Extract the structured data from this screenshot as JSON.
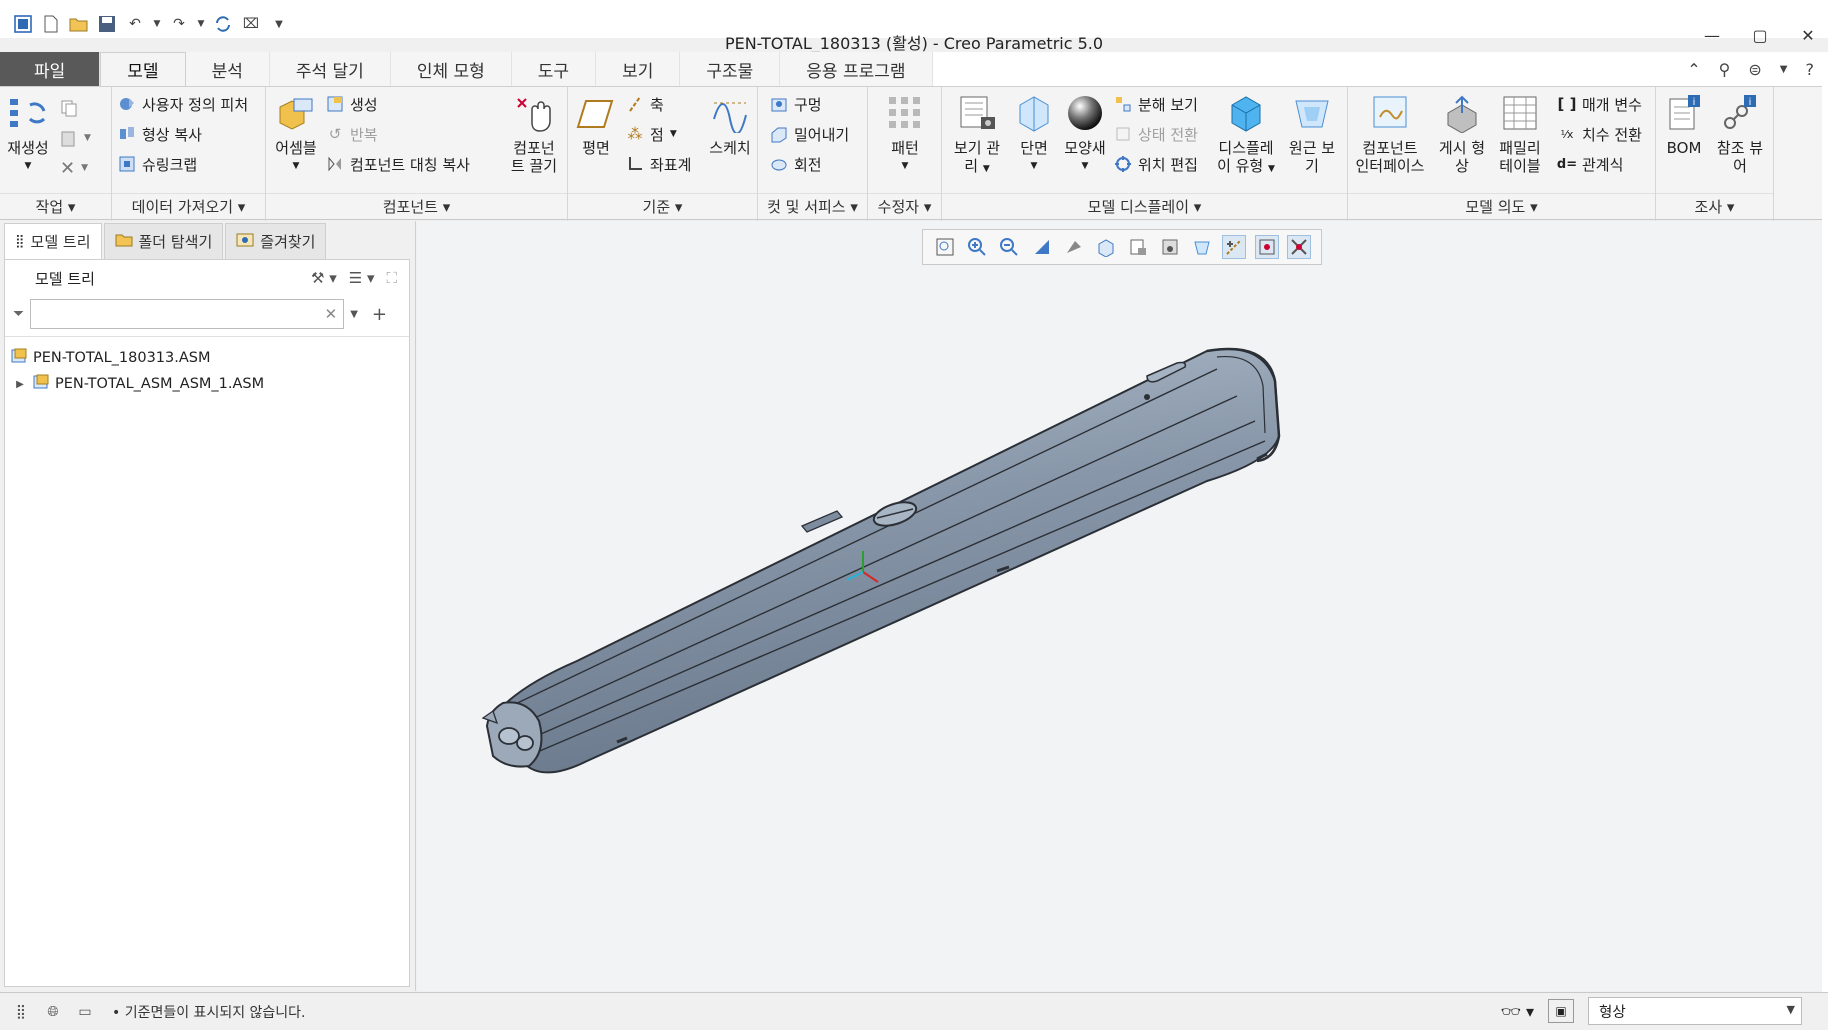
{
  "window": {
    "title": "PEN-TOTAL_180313 (활성) - Creo Parametric 5.0"
  },
  "tabs": [
    {
      "label": "파일"
    },
    {
      "label": "모델"
    },
    {
      "label": "분석"
    },
    {
      "label": "주석 달기"
    },
    {
      "label": "인체 모형"
    },
    {
      "label": "도구"
    },
    {
      "label": "보기"
    },
    {
      "label": "구조물"
    },
    {
      "label": "응용 프로그램"
    }
  ],
  "ribbon": {
    "groups": {
      "operations": "작업",
      "get_data": "데이터 가져오기",
      "component": "컴포넌트",
      "datum": "기준",
      "cut_surface": "컷 및 서피스",
      "modifiers": "수정자",
      "model_display": "모델 디스플레이",
      "model_intent": "모델 의도",
      "investigate": "조사"
    },
    "buttons": {
      "regenerate": "재생성",
      "user_defined_feature": "사용자 정의 피처",
      "copy_geometry": "형상 복사",
      "shrinkwrap": "슈링크랩",
      "assemble": "어셈블",
      "create": "생성",
      "repeat": "반복",
      "mirror_component": "컴포넌트 대칭 복사",
      "drag_components_1": "컴포넌",
      "drag_components_2": "트 끌기",
      "plane": "평면",
      "axis": "축",
      "point": "점",
      "coord_sys": "좌표계",
      "sketch": "스케치",
      "hole": "구멍",
      "extrude": "밀어내기",
      "revolve": "회전",
      "pattern": "패턴",
      "view_manager_1": "보기 관",
      "view_manager_2": "리",
      "section": "단면",
      "appearance": "모양새",
      "exploded_view": "분해 보기",
      "toggle_status": "상태 전환",
      "edit_position": "위치 편집",
      "display_style_1": "디스플레",
      "display_style_2": "이 유형",
      "perspective_1": "원근 보",
      "perspective_2": "기",
      "component_interface_1": "컴포넌트",
      "component_interface_2": "인터페이스",
      "publish_geometry_1": "게시 형",
      "publish_geometry_2": "상",
      "family_table_1": "패밀리",
      "family_table_2": "테이블",
      "parameters": "매개 변수",
      "switch_dimensions": "치수 전환",
      "relations": "관계식",
      "bom": "BOM",
      "reference_viewer_1": "참조 뷰",
      "reference_viewer_2": "어"
    }
  },
  "left_panel": {
    "tabs": [
      {
        "label": "모델 트리"
      },
      {
        "label": "폴더 탐색기"
      },
      {
        "label": "즐겨찾기"
      }
    ],
    "tree_title": "모델 트리",
    "filter_placeholder": "",
    "tree_items": [
      {
        "label": "PEN-TOTAL_180313.ASM"
      },
      {
        "label": "PEN-TOTAL_ASM_ASM_1.ASM"
      }
    ]
  },
  "status": {
    "message": "• 기준면들이 표시되지 않습니다.",
    "filter_selected": "형상"
  },
  "colors": {
    "file_tab": "#595959",
    "model_body": "#8a99ab",
    "model_edge": "#2b2f36"
  }
}
